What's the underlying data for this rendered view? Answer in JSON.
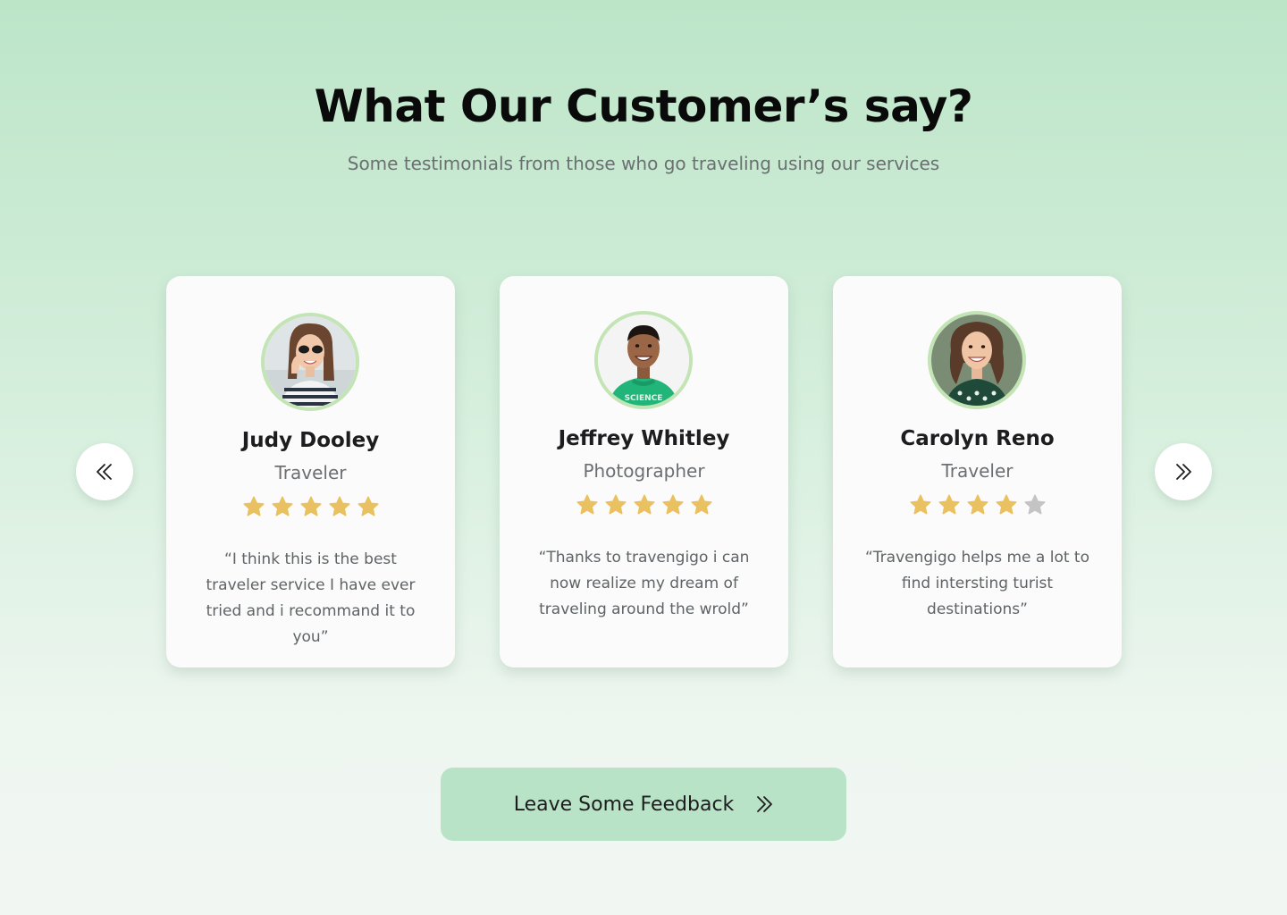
{
  "section": {
    "title": "What Our Customer’s say?",
    "subtitle": "Some testimonials from those who go traveling using our services"
  },
  "navigation": {
    "prev_icon": "double-chevron-left-icon",
    "next_icon": "double-chevron-right-icon"
  },
  "testimonials": [
    {
      "name": "Judy Dooley",
      "role": "Traveler",
      "rating": 5,
      "max_rating": 5,
      "quote": "“I think this is the best traveler service I have ever tried and i recommand it to you”"
    },
    {
      "name": "Jeffrey Whitley",
      "role": "Photographer",
      "rating": 5,
      "max_rating": 5,
      "quote": "“Thanks to travengigo i can now realize my dream of traveling around the wrold”"
    },
    {
      "name": "Carolyn Reno",
      "role": "Traveler",
      "rating": 4,
      "max_rating": 5,
      "quote": "“Travengigo helps me a lot to find intersting turist destinations”"
    }
  ],
  "cta": {
    "label": "Leave Some Feedback",
    "icon": "double-chevron-right-icon"
  },
  "colors": {
    "star_filled": "#eac161",
    "star_empty": "#c4c4c4",
    "avatar_ring": "#c3e4b4",
    "cta_background": "#b8e3c6"
  }
}
